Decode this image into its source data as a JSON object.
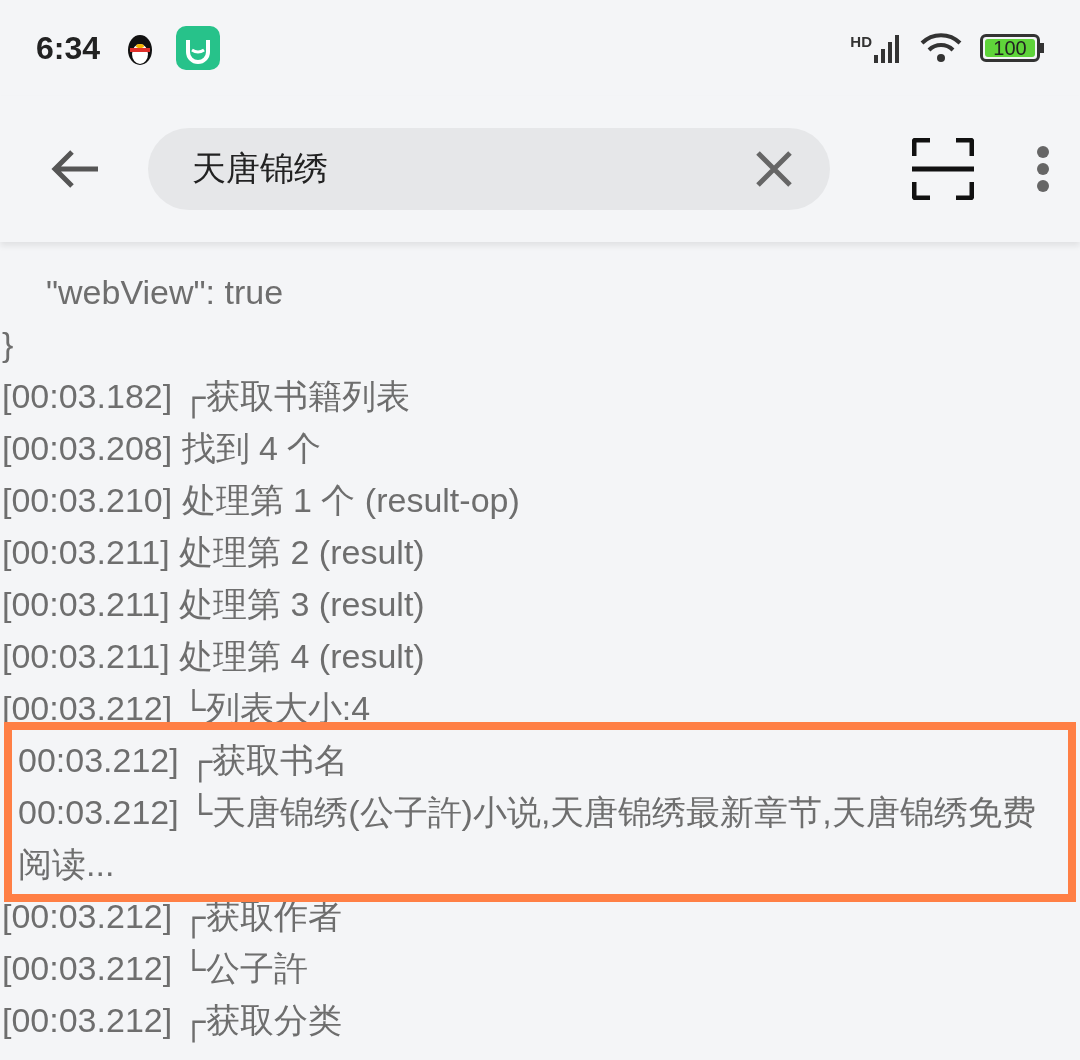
{
  "status_bar": {
    "time": "6:34",
    "network": "HD",
    "battery": "100"
  },
  "toolbar": {
    "search": {
      "value": "天唐锦绣"
    }
  },
  "log": [
    {
      "kind": "indented",
      "text": "\"webView\": true"
    },
    {
      "kind": "plain",
      "text": "}"
    },
    {
      "kind": "plain",
      "text": "[00:03.182] ┌获取书籍列表"
    },
    {
      "kind": "plain",
      "text": "[00:03.208] 找到 4 个"
    },
    {
      "kind": "plain",
      "text": "[00:03.210] 处理第 1 个 (result-op)"
    },
    {
      "kind": "plain",
      "text": "[00:03.211] 处理第 2 (result)"
    },
    {
      "kind": "plain",
      "text": "[00:03.211] 处理第 3 (result)"
    },
    {
      "kind": "plain",
      "text": "[00:03.211] 处理第 4 (result)"
    },
    {
      "kind": "plain",
      "text": "[00:03.212] └列表大小:4"
    },
    {
      "kind": "highlight",
      "lines": [
        "00:03.212] ┌获取书名",
        "00:03.212] └天唐锦绣(公子許)小说,天唐锦绣最新章节,天唐锦绣免费阅读..."
      ]
    },
    {
      "kind": "plain",
      "text": "[00:03.212] ┌获取作者"
    },
    {
      "kind": "plain",
      "text": "[00:03.212] └公子許"
    },
    {
      "kind": "plain",
      "text": "[00:03.212] ┌获取分类"
    }
  ]
}
